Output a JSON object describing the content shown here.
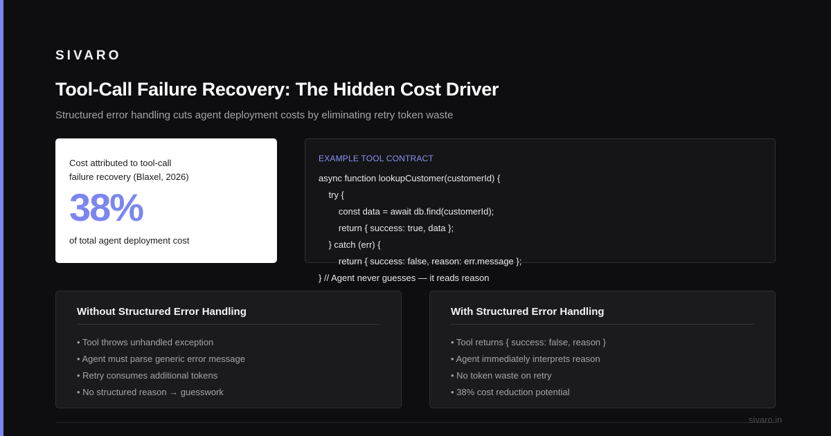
{
  "brand": "SIVARO",
  "title": "Tool-Call Failure Recovery: The Hidden Cost Driver",
  "subtitle": "Structured error handling cuts agent deployment costs by eliminating retry token waste",
  "stat": {
    "label": "Cost attributed to tool-call failure recovery (Blaxel, 2026)",
    "value": "38%",
    "caption": "of total agent deployment cost"
  },
  "code": {
    "heading": "EXAMPLE TOOL CONTRACT",
    "lines": [
      "async function lookupCustomer(customerId) {",
      "    try {",
      "        const data = await db.find(customerId);",
      "        return { success: true, data };",
      "    } catch (err) {",
      "        return { success: false, reason: err.message };",
      "} // Agent never guesses — it reads reason"
    ]
  },
  "without_panel": {
    "title": "Without Structured Error Handling",
    "items": [
      "• Tool throws unhandled exception",
      "• Agent must parse generic error message",
      "• Retry consumes additional tokens",
      "• No structured reason → guesswork"
    ]
  },
  "with_panel": {
    "title": "With Structured Error Handling",
    "items": [
      "• Tool returns { success: false, reason }",
      "• Agent immediately interprets reason",
      "• No token waste on retry",
      "• 38% cost reduction potential"
    ]
  },
  "footer": {
    "url": "sivaro.in"
  },
  "colors": {
    "accent": "#7c86f0",
    "background": "#0e0e10",
    "card": "#ffffff",
    "panel": "#1b1b1e"
  }
}
